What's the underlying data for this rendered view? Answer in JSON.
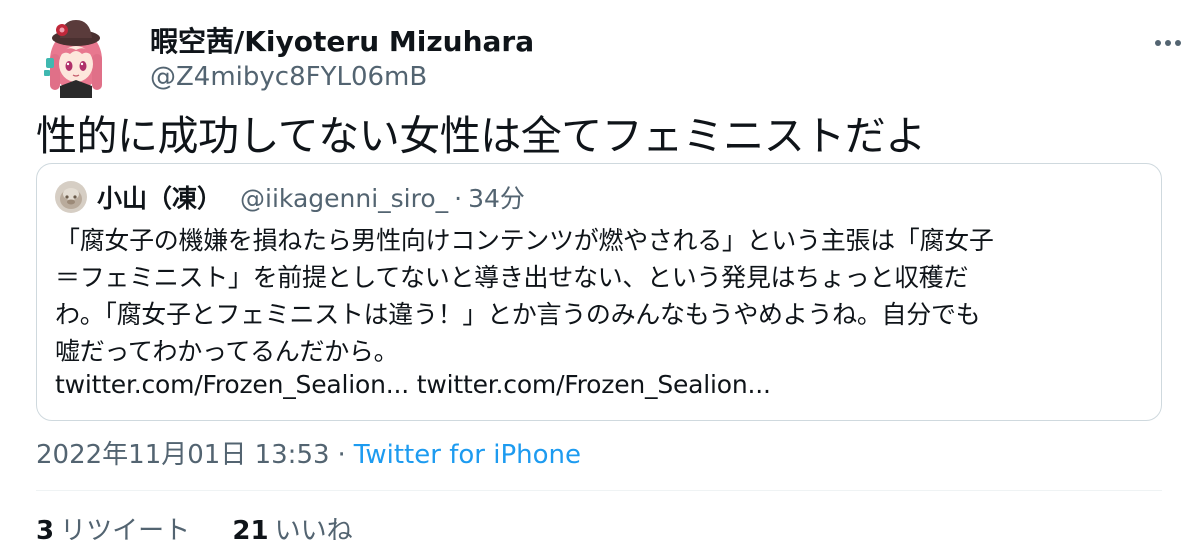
{
  "author": {
    "display_name": "暇空茜/Kiyoteru Mizuhara",
    "handle": "@Z4mibyc8FYL06mB"
  },
  "tweet": {
    "text": "性的に成功してない女性は全てフェミニストだよ"
  },
  "quoted_tweet": {
    "display_name": "小山（凍）",
    "handle": "@iikagenni_siro_",
    "separator": "·",
    "time": "34分",
    "lines": [
      "「腐女子の機嫌を損ねたら男性向けコンテンツが燃やされる」という主張は「腐女子",
      "＝フェミニスト」を前提としてないと導き出せない、という発見はちょっと収穫だ",
      "わ。「腐女子とフェミニストは違う！」とか言うのみんなもうやめようね。自分でも",
      "嘘だってわかってるんだから。"
    ],
    "links": [
      "twitter.com/Frozen_Sealion...",
      "twitter.com/Frozen_Sealion..."
    ]
  },
  "meta": {
    "timestamp": "2022年11月01日 13:53",
    "separator": "·",
    "source": "Twitter for iPhone"
  },
  "stats": {
    "retweets_count": "3",
    "retweets_label": "リツイート",
    "likes_count": "21",
    "likes_label": "いいね"
  },
  "colors": {
    "text_primary": "#0f1419",
    "text_secondary": "#536471",
    "link_blue": "#1d9bf0",
    "border": "#cfd9de",
    "avatar_hair": "#e8788f",
    "avatar_hat": "#5a3b3b"
  },
  "icons": {
    "avatar": "anime-girl-avatar",
    "more": "more-horizontal-icon",
    "quote_avatar": "quote-user-avatar"
  }
}
